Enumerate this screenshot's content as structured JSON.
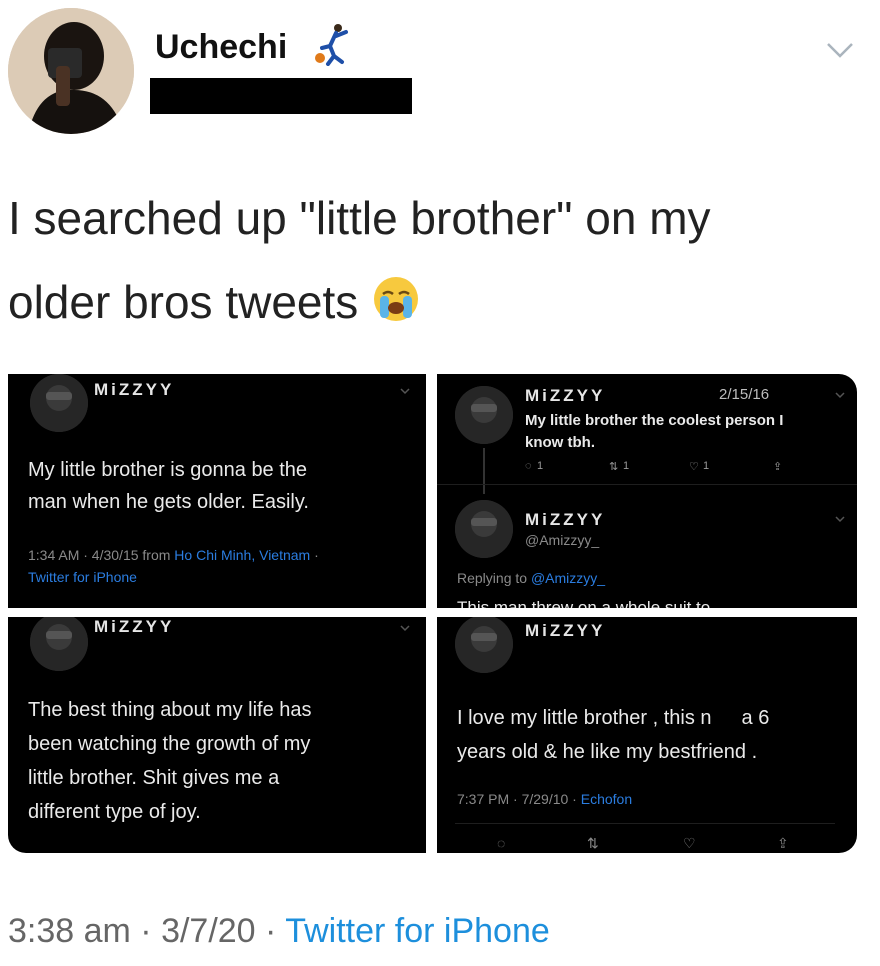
{
  "author": {
    "name": "Uchechi",
    "emoji": "⛹"
  },
  "tweet": {
    "line1": "I searched up \"little brother\" on my",
    "line2": "older bros tweets",
    "emoji": "😭"
  },
  "panels": {
    "top_left": {
      "name": "MiZZYY",
      "body_line1": "My little brother is gonna be the",
      "body_line2": "man when he gets older. Easily.",
      "meta_time": "1:34 AM · 4/30/15 from ",
      "meta_place": "Ho Chi Minh, Vietnam",
      "meta_sep": " ·",
      "meta_source": "Twitter for iPhone"
    },
    "top_right": {
      "name": "MiZZYY",
      "date": "2/15/16",
      "body_line1": "My little brother the coolest person I",
      "body_line2": "know tbh.",
      "reply_count": "1",
      "retweet_count": "1",
      "like_count": "1",
      "name2": "MiZZYY",
      "handle2": "@Amizzyy_",
      "replying_prefix": "Replying to ",
      "replying_handle": "@Amizzyy_",
      "cut_text": "This man threw on a whole suit to"
    },
    "bottom_left": {
      "name": "MiZZYY",
      "body_line1": "The best thing about my life has",
      "body_line2": "been watching the growth of my",
      "body_line3": "little brother. Shit gives me a",
      "body_line4": "different type of joy."
    },
    "bottom_right": {
      "name": "MiZZYY",
      "body_line1a": "I love my little brother , this n",
      "body_line1b": "a 6",
      "body_line2": "years old & he like my bestfriend .",
      "meta_time": "7:37 PM · 7/29/10 · ",
      "meta_source": "Echofon"
    }
  },
  "footer": {
    "time": "3:38 am · 3/7/20 · ",
    "source": "Twitter for iPhone"
  }
}
